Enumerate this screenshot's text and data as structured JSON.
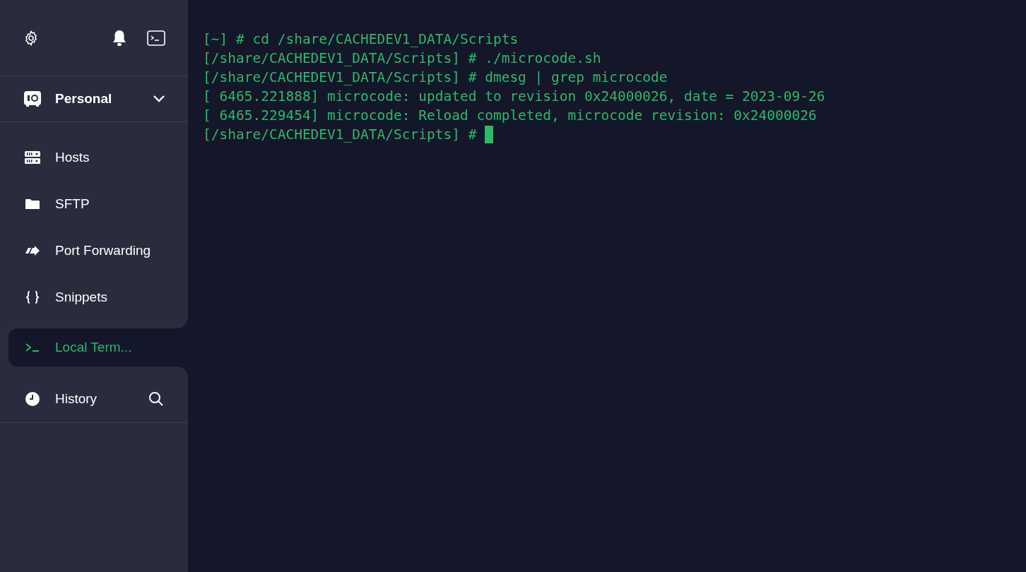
{
  "sidebar": {
    "vault": {
      "label": "Personal"
    },
    "items": [
      {
        "kind": "hosts",
        "label": "Hosts",
        "selected": false
      },
      {
        "kind": "sftp",
        "label": "SFTP",
        "selected": false
      },
      {
        "kind": "port_forwarding",
        "label": "Port Forwarding",
        "selected": false
      },
      {
        "kind": "snippets",
        "label": "Snippets",
        "selected": false
      },
      {
        "kind": "terminal",
        "label": "Local Term...",
        "selected": true
      },
      {
        "kind": "history",
        "label": "History",
        "selected": false
      }
    ]
  },
  "terminal": {
    "lines": [
      "[~] # cd /share/CACHEDEV1_DATA/Scripts",
      "[/share/CACHEDEV1_DATA/Scripts] # ./microcode.sh",
      "[/share/CACHEDEV1_DATA/Scripts] # dmesg | grep microcode",
      "[ 6465.221888] microcode: updated to revision 0x24000026, date = 2023-09-26",
      "[ 6465.229454] microcode: Reload completed, microcode revision: 0x24000026",
      "[/share/CACHEDEV1_DATA/Scripts] # "
    ]
  }
}
